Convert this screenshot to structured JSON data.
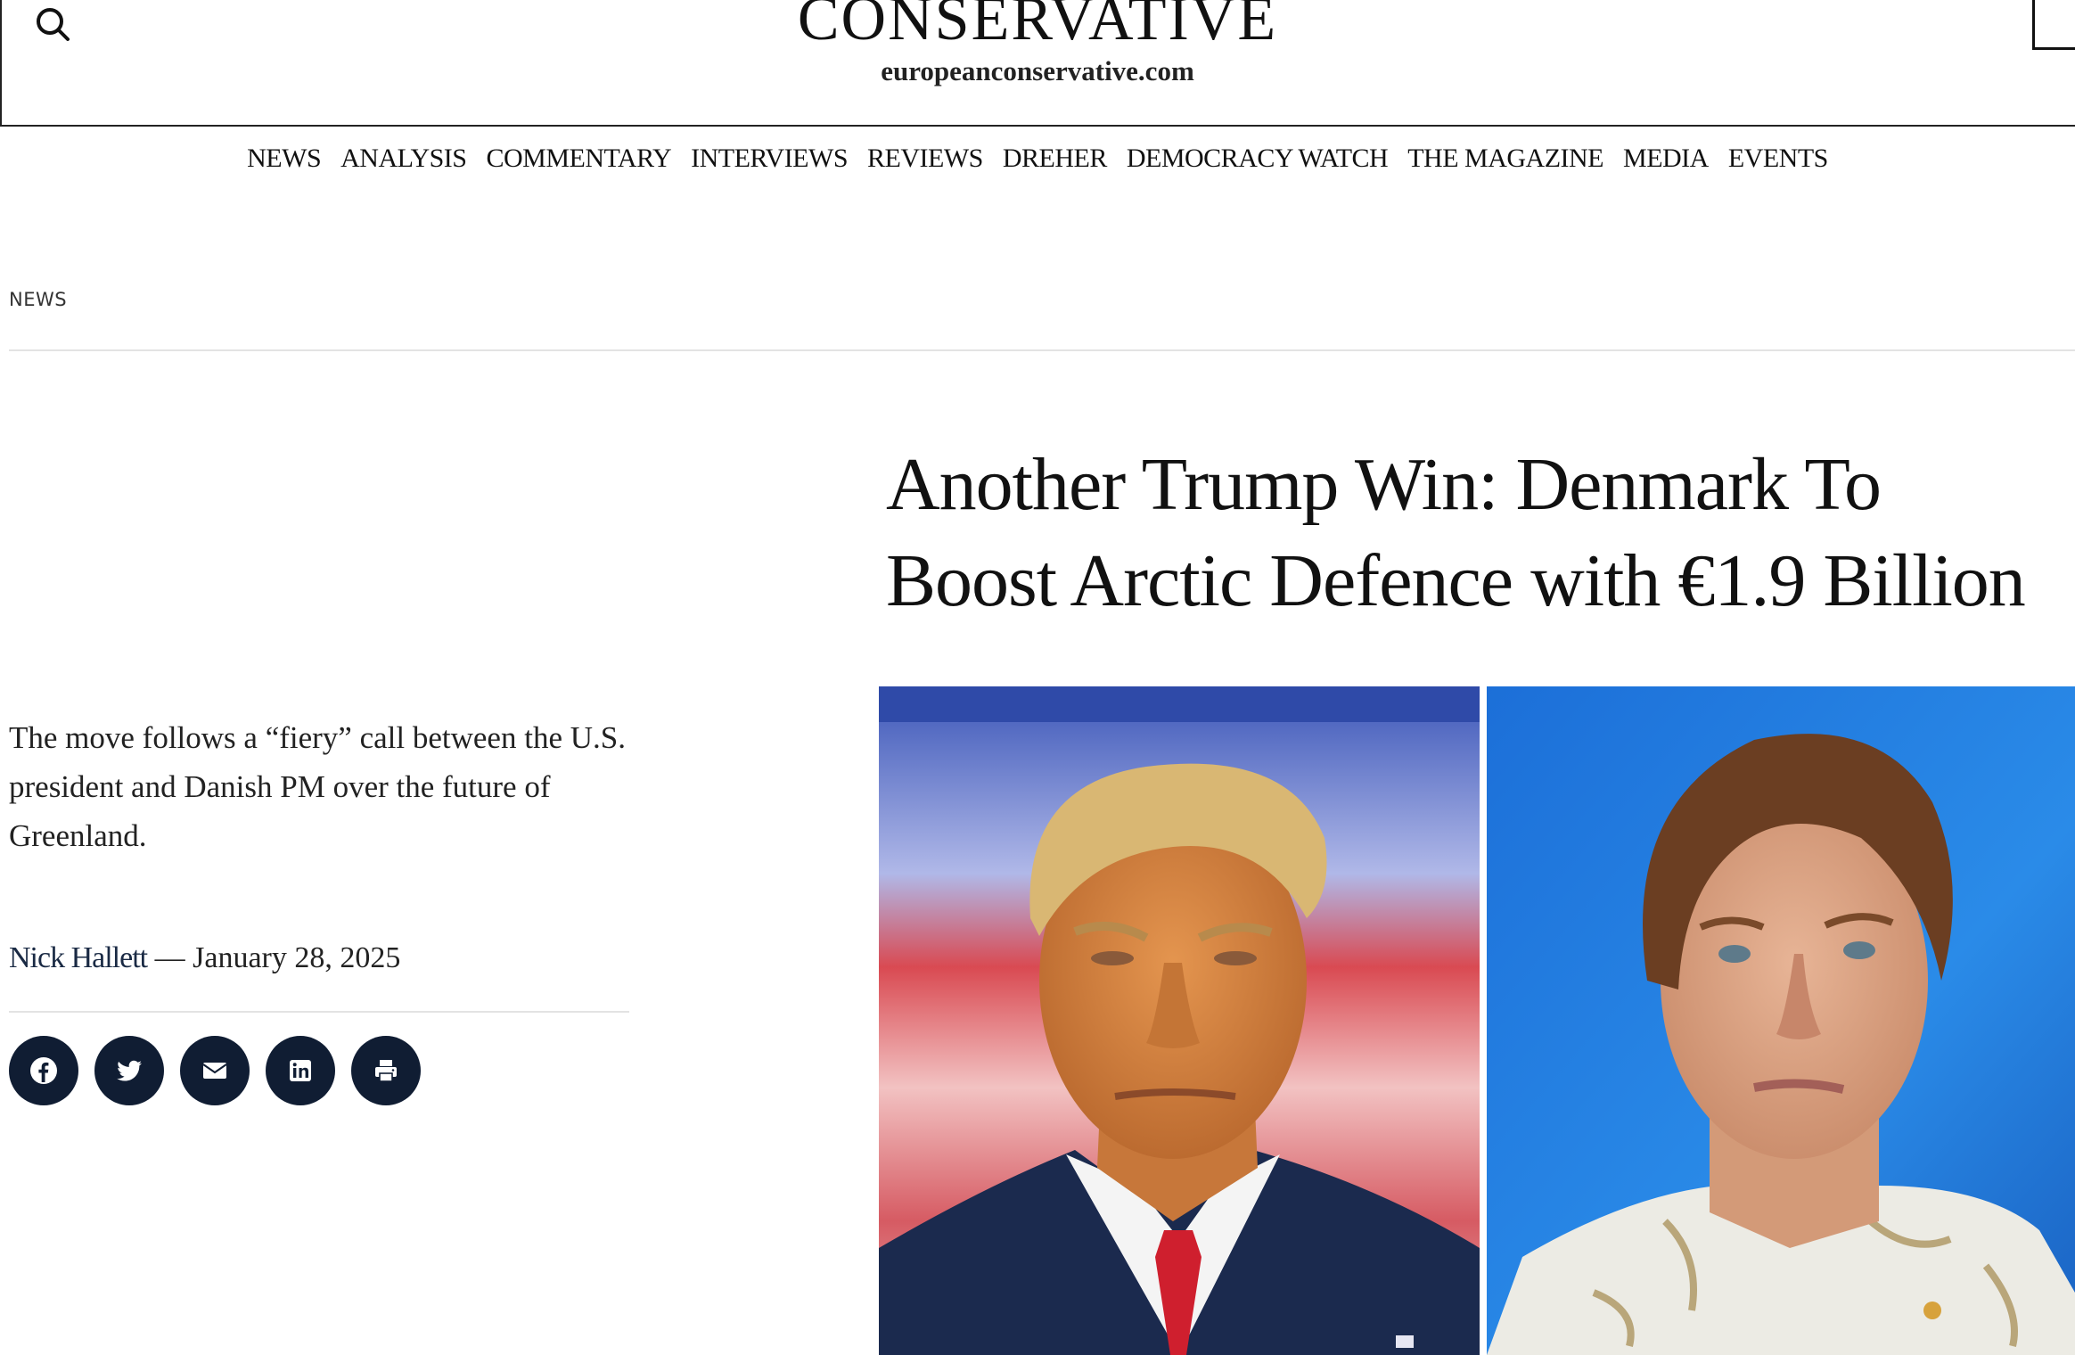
{
  "header": {
    "logo_word": "CONSERVATIVE",
    "logo_url": "europeanconservative.com"
  },
  "nav": {
    "items": [
      "NEWS",
      "ANALYSIS",
      "COMMENTARY",
      "INTERVIEWS",
      "REVIEWS",
      "DREHER",
      "DEMOCRACY WATCH",
      "THE MAGAZINE",
      "MEDIA",
      "EVENTS"
    ]
  },
  "article": {
    "category": "NEWS",
    "title": "Another Trump Win: Denmark To Boost Arctic Defence with €1.9 Billion",
    "excerpt": "The move follows a “fiery” call between the U.S. president and Danish PM over the future of Greenland.",
    "author": "Nick Hallett",
    "separator": " — ",
    "date": "January 28, 2025"
  },
  "share": {
    "icons": [
      "facebook-icon",
      "twitter-icon",
      "email-icon",
      "linkedin-icon",
      "print-icon"
    ]
  },
  "colors": {
    "share_bg": "#101d33",
    "text": "#111111",
    "rule": "#e3e3e3"
  }
}
